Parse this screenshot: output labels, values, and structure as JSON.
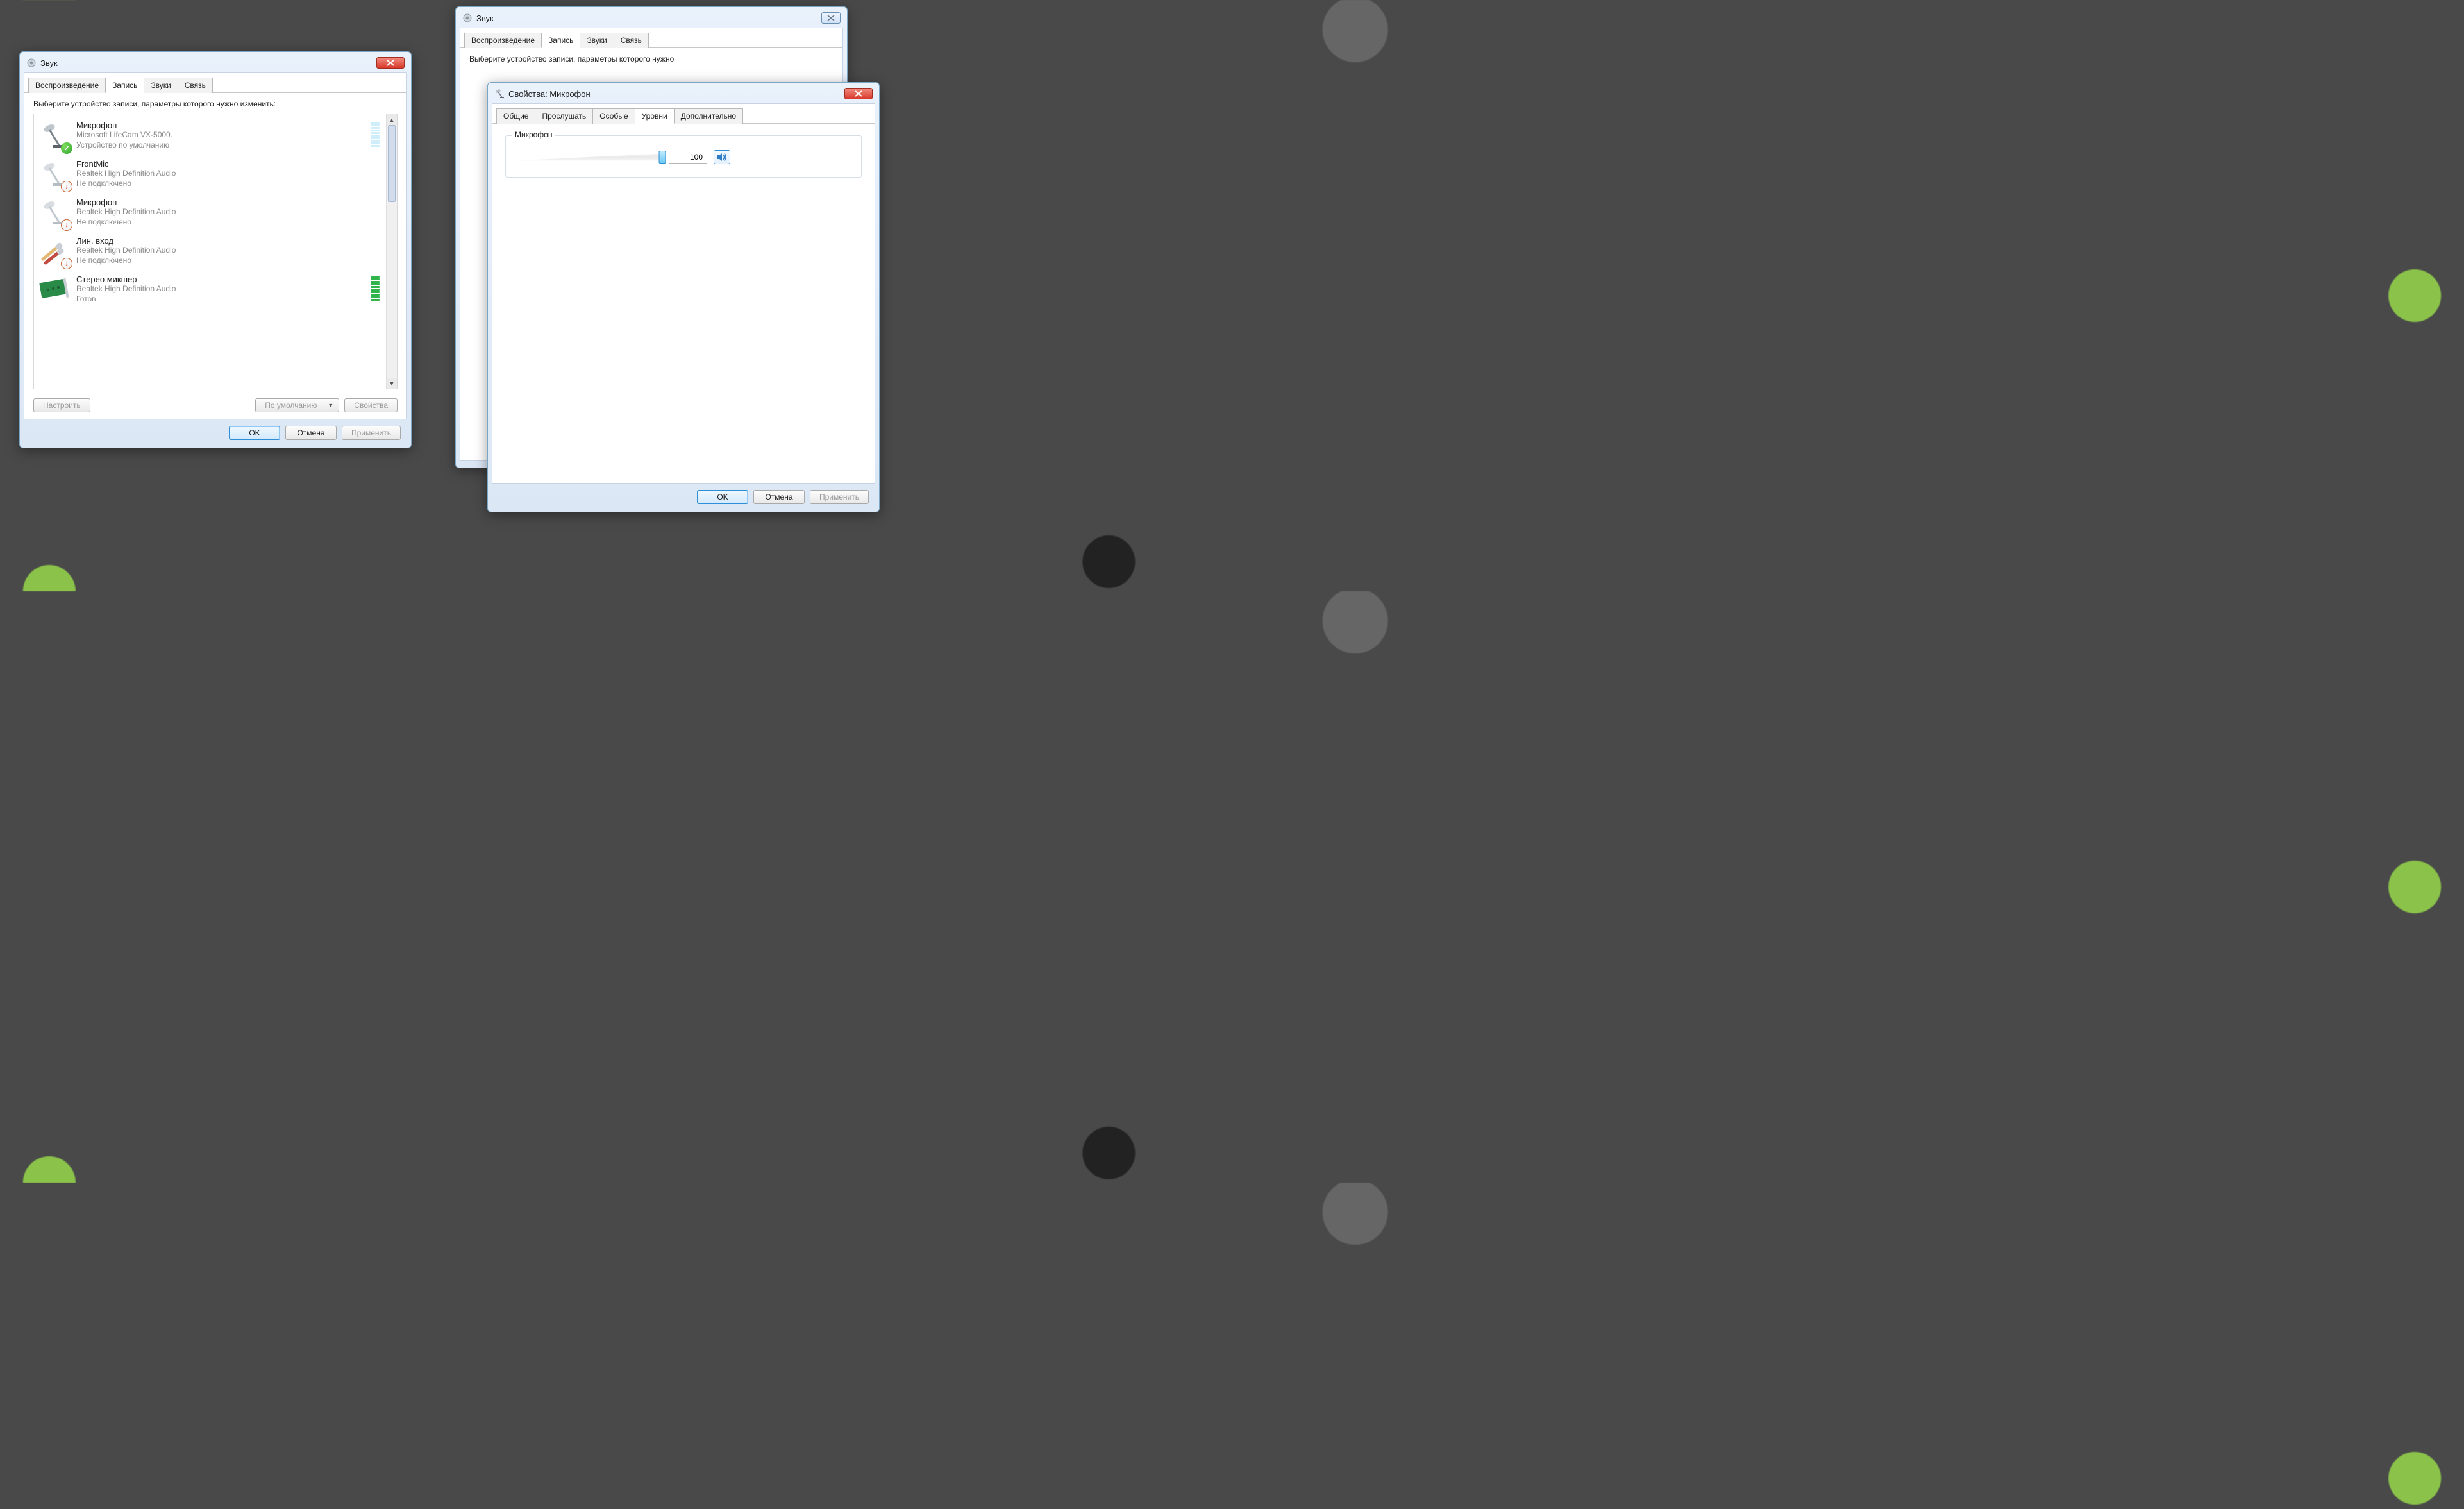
{
  "left_window": {
    "title": "Звук",
    "tabs": [
      "Воспроизведение",
      "Запись",
      "Звуки",
      "Связь"
    ],
    "active_tab_index": 1,
    "instruction": "Выберите устройство записи, параметры которого нужно изменить:",
    "devices": [
      {
        "name": "Микрофон",
        "line1": "Microsoft LifeCam VX-5000.",
        "line2": "Устройство по умолчанию",
        "status": "default",
        "meter": "partial"
      },
      {
        "name": "FrontMic",
        "line1": "Realtek High Definition Audio",
        "line2": "Не подключено",
        "status": "unplugged",
        "meter": "none"
      },
      {
        "name": "Микрофон",
        "line1": "Realtek High Definition Audio",
        "line2": "Не подключено",
        "status": "unplugged",
        "meter": "none"
      },
      {
        "name": "Лин. вход",
        "line1": "Realtek High Definition Audio",
        "line2": "Не подключено",
        "status": "unplugged",
        "meter": "none"
      },
      {
        "name": "Стерео микшер",
        "line1": "Realtek High Definition Audio",
        "line2": "Готов",
        "status": "ready",
        "meter": "active"
      }
    ],
    "btn_configure": "Настроить",
    "btn_default": "По умолчанию",
    "btn_properties": "Свойства",
    "btn_ok": "OK",
    "btn_cancel": "Отмена",
    "btn_apply": "Применить"
  },
  "back_window": {
    "title": "Звук",
    "tabs": [
      "Воспроизведение",
      "Запись",
      "Звуки",
      "Связь"
    ],
    "active_tab_index": 1,
    "instruction": "Выберите устройство записи, параметры которого нужно"
  },
  "props_window": {
    "title": "Свойства: Микрофон",
    "tabs": [
      "Общие",
      "Прослушать",
      "Особые",
      "Уровни",
      "Дополнительно"
    ],
    "active_tab_index": 3,
    "group_label": "Микрофон",
    "level_value": "100",
    "btn_ok": "OK",
    "btn_cancel": "Отмена",
    "btn_apply": "Применить"
  }
}
